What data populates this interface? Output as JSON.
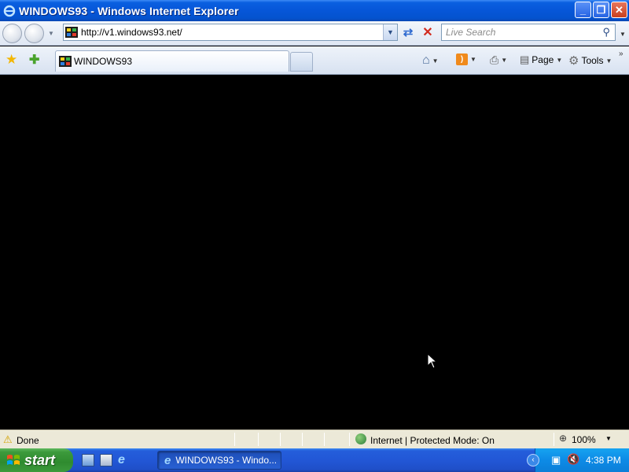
{
  "window": {
    "title": "WINDOWS93 - Windows Internet Explorer",
    "controls": {
      "minimize": "_",
      "maximize": "❐",
      "close": "✕"
    }
  },
  "address": {
    "url": "http://v1.windows93.net/"
  },
  "search": {
    "placeholder": "Live Search"
  },
  "tabs": [
    {
      "label": "WINDOWS93",
      "active": true
    }
  ],
  "commands": {
    "page": "Page",
    "tools": "Tools"
  },
  "status": {
    "text": "Done",
    "zone": "Internet | Protected Mode: On",
    "zoom": "100%"
  },
  "taskbar": {
    "start": "start",
    "task_label": "WINDOWS93 - Windo...",
    "clock": "4:38 PM"
  },
  "colors": {
    "titlebar": "#0656d8",
    "content_bg": "#000000",
    "start_green": "#2f8b2f",
    "tray_blue": "#0d8be6"
  }
}
